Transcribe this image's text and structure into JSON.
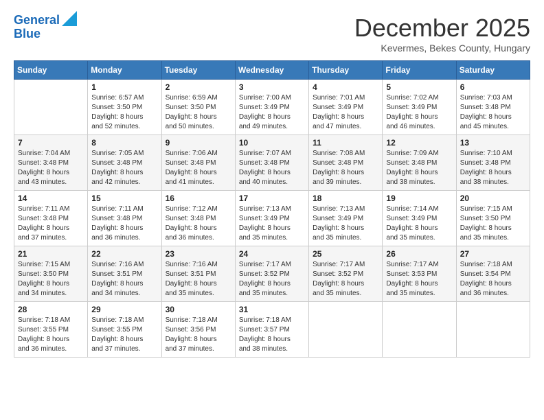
{
  "logo": {
    "line1": "General",
    "line2": "Blue"
  },
  "title": "December 2025",
  "location": "Kevermes, Bekes County, Hungary",
  "days_header": [
    "Sunday",
    "Monday",
    "Tuesday",
    "Wednesday",
    "Thursday",
    "Friday",
    "Saturday"
  ],
  "weeks": [
    [
      {
        "day": "",
        "info": ""
      },
      {
        "day": "1",
        "info": "Sunrise: 6:57 AM\nSunset: 3:50 PM\nDaylight: 8 hours\nand 52 minutes."
      },
      {
        "day": "2",
        "info": "Sunrise: 6:59 AM\nSunset: 3:50 PM\nDaylight: 8 hours\nand 50 minutes."
      },
      {
        "day": "3",
        "info": "Sunrise: 7:00 AM\nSunset: 3:49 PM\nDaylight: 8 hours\nand 49 minutes."
      },
      {
        "day": "4",
        "info": "Sunrise: 7:01 AM\nSunset: 3:49 PM\nDaylight: 8 hours\nand 47 minutes."
      },
      {
        "day": "5",
        "info": "Sunrise: 7:02 AM\nSunset: 3:49 PM\nDaylight: 8 hours\nand 46 minutes."
      },
      {
        "day": "6",
        "info": "Sunrise: 7:03 AM\nSunset: 3:48 PM\nDaylight: 8 hours\nand 45 minutes."
      }
    ],
    [
      {
        "day": "7",
        "info": "Sunrise: 7:04 AM\nSunset: 3:48 PM\nDaylight: 8 hours\nand 43 minutes."
      },
      {
        "day": "8",
        "info": "Sunrise: 7:05 AM\nSunset: 3:48 PM\nDaylight: 8 hours\nand 42 minutes."
      },
      {
        "day": "9",
        "info": "Sunrise: 7:06 AM\nSunset: 3:48 PM\nDaylight: 8 hours\nand 41 minutes."
      },
      {
        "day": "10",
        "info": "Sunrise: 7:07 AM\nSunset: 3:48 PM\nDaylight: 8 hours\nand 40 minutes."
      },
      {
        "day": "11",
        "info": "Sunrise: 7:08 AM\nSunset: 3:48 PM\nDaylight: 8 hours\nand 39 minutes."
      },
      {
        "day": "12",
        "info": "Sunrise: 7:09 AM\nSunset: 3:48 PM\nDaylight: 8 hours\nand 38 minutes."
      },
      {
        "day": "13",
        "info": "Sunrise: 7:10 AM\nSunset: 3:48 PM\nDaylight: 8 hours\nand 38 minutes."
      }
    ],
    [
      {
        "day": "14",
        "info": "Sunrise: 7:11 AM\nSunset: 3:48 PM\nDaylight: 8 hours\nand 37 minutes."
      },
      {
        "day": "15",
        "info": "Sunrise: 7:11 AM\nSunset: 3:48 PM\nDaylight: 8 hours\nand 36 minutes."
      },
      {
        "day": "16",
        "info": "Sunrise: 7:12 AM\nSunset: 3:48 PM\nDaylight: 8 hours\nand 36 minutes."
      },
      {
        "day": "17",
        "info": "Sunrise: 7:13 AM\nSunset: 3:49 PM\nDaylight: 8 hours\nand 35 minutes."
      },
      {
        "day": "18",
        "info": "Sunrise: 7:13 AM\nSunset: 3:49 PM\nDaylight: 8 hours\nand 35 minutes."
      },
      {
        "day": "19",
        "info": "Sunrise: 7:14 AM\nSunset: 3:49 PM\nDaylight: 8 hours\nand 35 minutes."
      },
      {
        "day": "20",
        "info": "Sunrise: 7:15 AM\nSunset: 3:50 PM\nDaylight: 8 hours\nand 35 minutes."
      }
    ],
    [
      {
        "day": "21",
        "info": "Sunrise: 7:15 AM\nSunset: 3:50 PM\nDaylight: 8 hours\nand 34 minutes."
      },
      {
        "day": "22",
        "info": "Sunrise: 7:16 AM\nSunset: 3:51 PM\nDaylight: 8 hours\nand 34 minutes."
      },
      {
        "day": "23",
        "info": "Sunrise: 7:16 AM\nSunset: 3:51 PM\nDaylight: 8 hours\nand 35 minutes."
      },
      {
        "day": "24",
        "info": "Sunrise: 7:17 AM\nSunset: 3:52 PM\nDaylight: 8 hours\nand 35 minutes."
      },
      {
        "day": "25",
        "info": "Sunrise: 7:17 AM\nSunset: 3:52 PM\nDaylight: 8 hours\nand 35 minutes."
      },
      {
        "day": "26",
        "info": "Sunrise: 7:17 AM\nSunset: 3:53 PM\nDaylight: 8 hours\nand 35 minutes."
      },
      {
        "day": "27",
        "info": "Sunrise: 7:18 AM\nSunset: 3:54 PM\nDaylight: 8 hours\nand 36 minutes."
      }
    ],
    [
      {
        "day": "28",
        "info": "Sunrise: 7:18 AM\nSunset: 3:55 PM\nDaylight: 8 hours\nand 36 minutes."
      },
      {
        "day": "29",
        "info": "Sunrise: 7:18 AM\nSunset: 3:55 PM\nDaylight: 8 hours\nand 37 minutes."
      },
      {
        "day": "30",
        "info": "Sunrise: 7:18 AM\nSunset: 3:56 PM\nDaylight: 8 hours\nand 37 minutes."
      },
      {
        "day": "31",
        "info": "Sunrise: 7:18 AM\nSunset: 3:57 PM\nDaylight: 8 hours\nand 38 minutes."
      },
      {
        "day": "",
        "info": ""
      },
      {
        "day": "",
        "info": ""
      },
      {
        "day": "",
        "info": ""
      }
    ]
  ]
}
